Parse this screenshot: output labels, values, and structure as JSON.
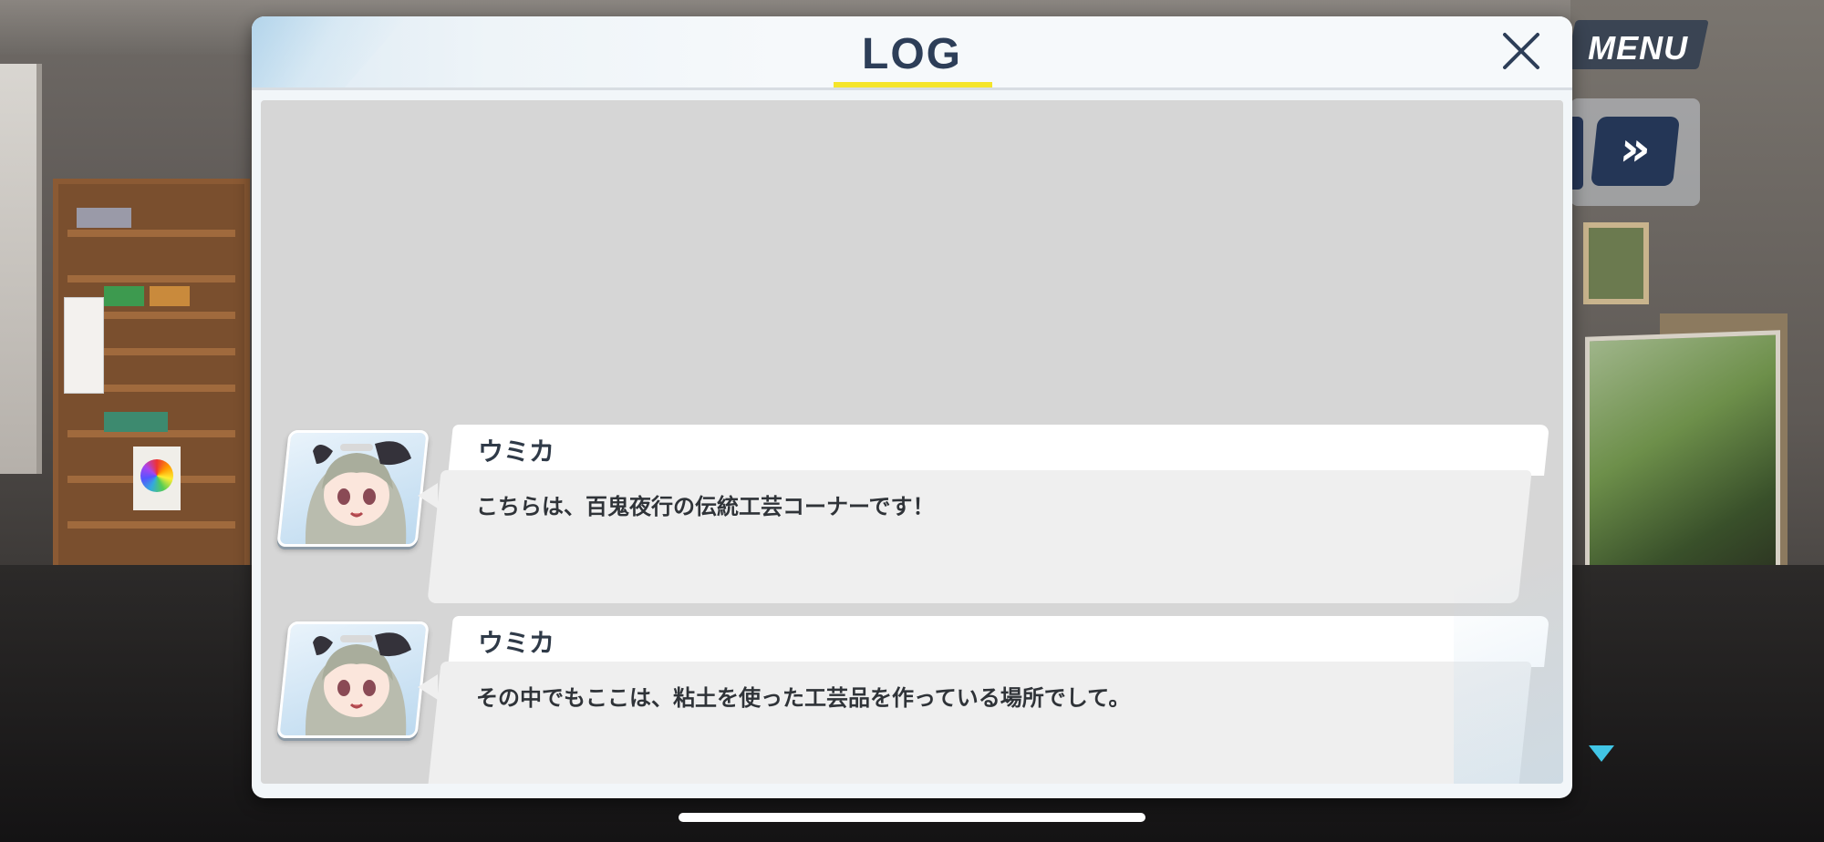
{
  "window": {
    "title": "LOG"
  },
  "hud": {
    "menu_label": "MENU",
    "skip_label": "»"
  },
  "entries": [
    {
      "speaker": "ウミカ",
      "text": "こちらは、百鬼夜行の伝統工芸コーナーです！"
    },
    {
      "speaker": "ウミカ",
      "text": "その中でもここは、粘土を使った工芸品を作っている場所でして。"
    }
  ],
  "colors": {
    "title": "#2d3e58",
    "title_underline": "#f5e52a",
    "hud_button": "#243656",
    "scroll_arrow": "#41c5e6"
  }
}
